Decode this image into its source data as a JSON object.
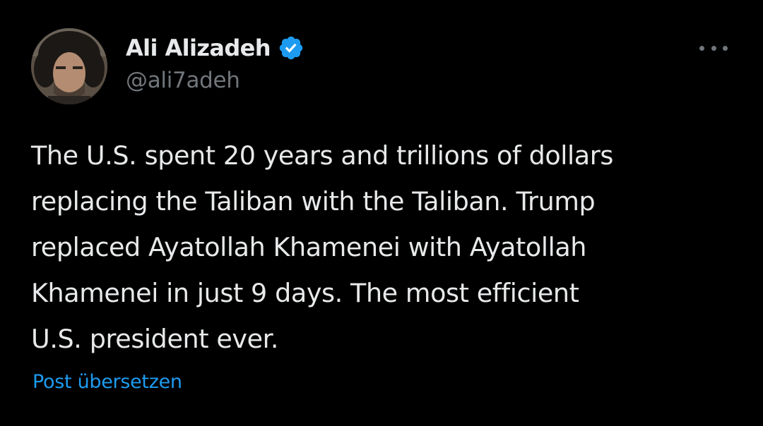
{
  "author": {
    "display_name": "Ali Alizadeh",
    "handle": "@ali7adeh",
    "verified": true,
    "avatar_icon": "profile-photo"
  },
  "post": {
    "text_lines": [
      "The U.S. spent 20 years and trillions of dollars",
      "replacing the Taliban with the Taliban. Trump",
      "replaced Ayatollah Khamenei with Ayatollah",
      "Khamenei in just 9 days. The most efficient",
      "U.S. president ever."
    ]
  },
  "actions": {
    "more_icon": "more-horizontal-icon",
    "translate_label": "Post übersetzen"
  },
  "colors": {
    "background": "#000000",
    "text_primary": "#e7e9ea",
    "text_secondary": "#71767b",
    "accent": "#1d9bf0"
  }
}
